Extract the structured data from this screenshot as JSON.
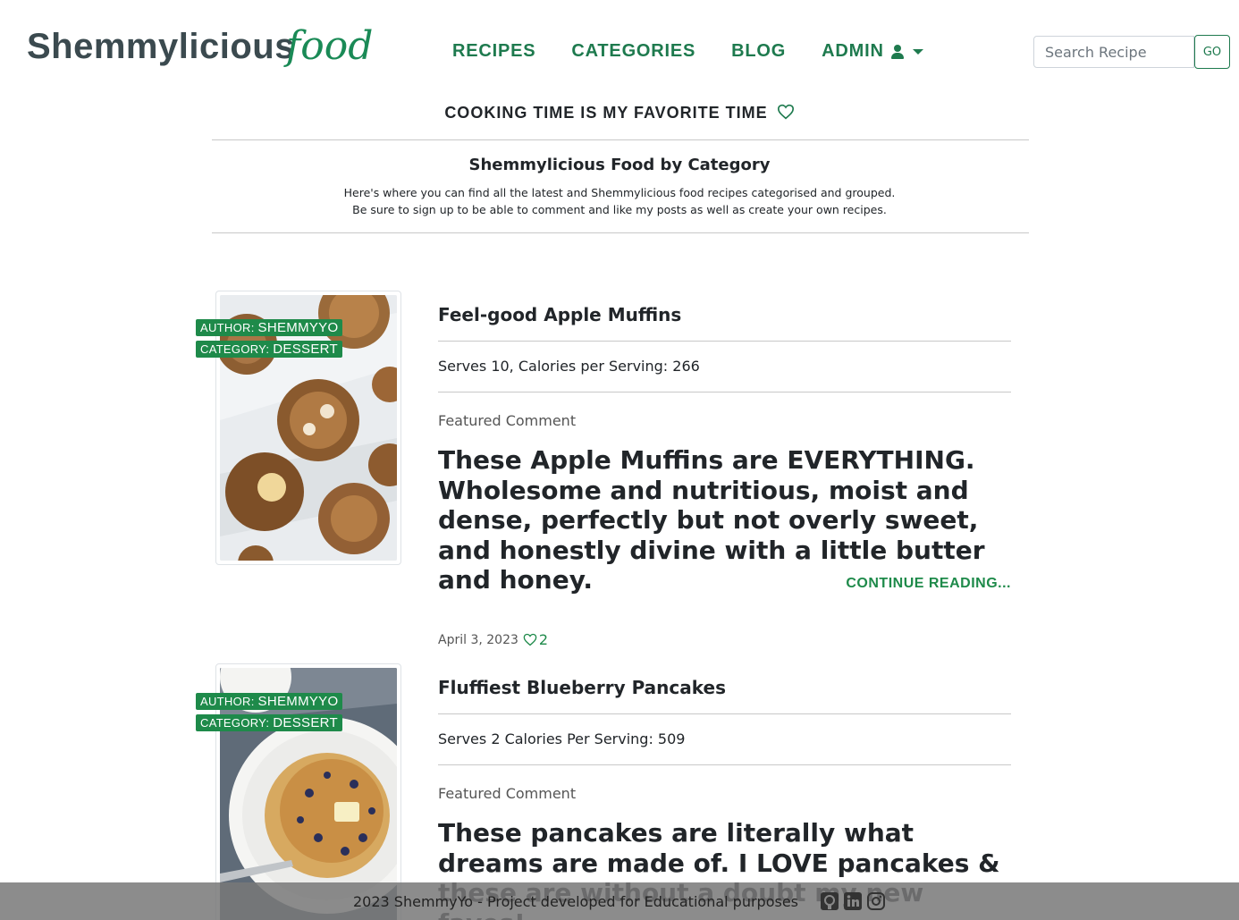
{
  "header": {
    "logo_main": "Shemmylicious",
    "logo_script": "food",
    "nav": [
      {
        "label": "RECIPES"
      },
      {
        "label": "CATEGORIES"
      },
      {
        "label": "BLOG"
      },
      {
        "label": "ADMIN"
      }
    ],
    "search": {
      "placeholder": "Search Recipe",
      "button_label": "GO"
    }
  },
  "tagline": "COOKING TIME IS MY FAVORITE TIME",
  "intro": {
    "title": "Shemmylicious Food by Category",
    "line1": "Here's where you can find all the latest and Shemmylicious food recipes categorised and grouped.",
    "line2": "Be sure to sign up to be able to comment and like my posts as well as create your own recipes."
  },
  "recipes": [
    {
      "author_label": "AUTHOR:",
      "author": "SHEMMYYO",
      "category_label": "CATEGORY:",
      "category": "DESSERT",
      "title": "Feel-good Apple Muffins",
      "serves": "Serves 10, Calories per Serving: 266",
      "featured_label": "Featured Comment",
      "comment": "These Apple Muffins are EVERYTHING. Wholesome and nutritious, moist and dense, perfectly but not overly sweet, and honestly divine with a little butter and honey.",
      "continue": "CONTINUE READING...",
      "image_icon": "apple-muffins-photo"
    },
    {
      "date": "April 3, 2023",
      "likes": "2",
      "author_label": "AUTHOR:",
      "author": "SHEMMYYO",
      "category_label": "CATEGORY:",
      "category": "DESSERT",
      "title": "Fluffiest Blueberry Pancakes",
      "serves": "Serves 2 Calories Per Serving: 509",
      "featured_label": "Featured Comment",
      "comment": "These pancakes are literally what dreams are made of. I LOVE pancakes & these are without a doubt my new faves!",
      "image_icon": "blueberry-pancakes-photo"
    }
  ],
  "footer": {
    "text": "2023 ShemmyYo - Project developed for Educational purposes",
    "icons": [
      "github-icon",
      "linkedin-icon",
      "instagram-icon"
    ]
  },
  "colors": {
    "brand_green": "#1e7a4e",
    "badge_green": "#1e8a4a",
    "logo_gray": "#3b4a4f"
  }
}
